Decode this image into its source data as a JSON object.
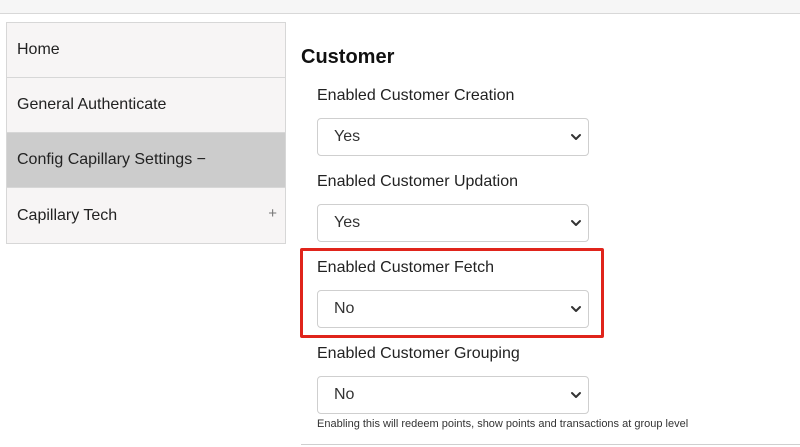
{
  "sidebar": {
    "items": [
      {
        "label": "Home",
        "toggle": ""
      },
      {
        "label": "General Authenticate",
        "toggle": ""
      },
      {
        "label": "Config Capillary Settings −",
        "toggle": ""
      },
      {
        "label": "Capillary Tech",
        "toggle": "+"
      }
    ],
    "active_index": 2
  },
  "main": {
    "section_title": "Customer",
    "fields": [
      {
        "label": "Enabled Customer Creation",
        "value": "Yes"
      },
      {
        "label": "Enabled Customer Updation",
        "value": "Yes"
      },
      {
        "label": "Enabled Customer Fetch",
        "value": "No"
      },
      {
        "label": "Enabled Customer Grouping",
        "value": "No",
        "help": "Enabling this will redeem points, show points and transactions at group level"
      }
    ]
  },
  "colors": {
    "highlight": "#e0241b",
    "active_item_bg": "#cccccc",
    "sidebar_bg": "#f7f5f5"
  }
}
